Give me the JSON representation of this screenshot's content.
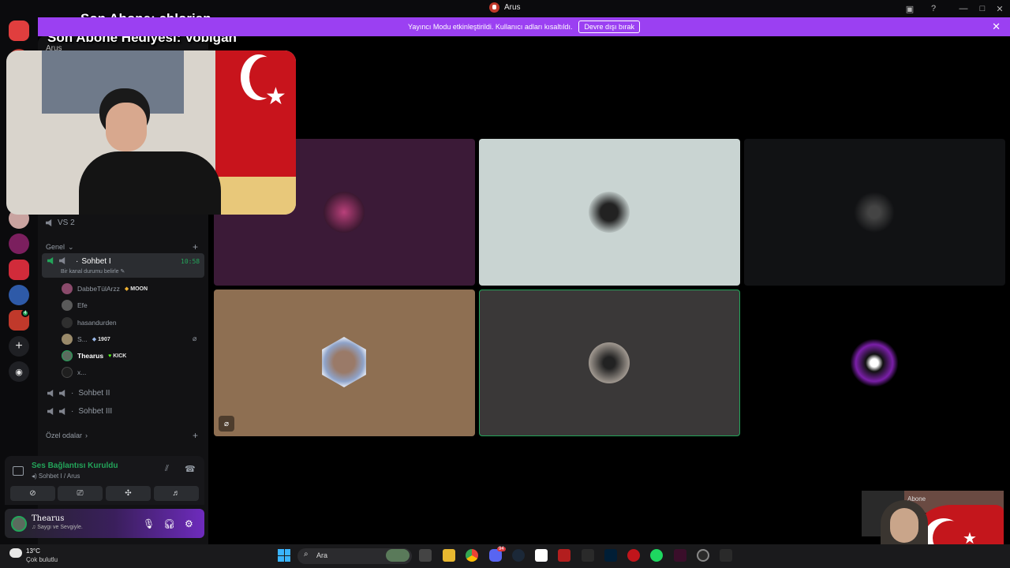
{
  "window": {
    "title": "Arus"
  },
  "banner": {
    "text": "Yayıncı Modu etkinleştirildi. Kullanıcı adları kısaltıldı.",
    "button": "Devre dışı bırak"
  },
  "overlay": {
    "line1": "Son Abone: chlorian",
    "line2": "Son Abone Hediyesi: Vobigan"
  },
  "server": {
    "name": "Arus"
  },
  "channels": {
    "vs2": "VS 2",
    "category_general": "Genel",
    "active": {
      "name": "Sohbet I",
      "time": "10:58",
      "status": "Bir kanal durumu belirle"
    },
    "members": [
      {
        "name": "DabbeTülArzz",
        "tag": "MOON"
      },
      {
        "name": "Efe",
        "tag": ""
      },
      {
        "name": "hasandurden",
        "tag": ""
      },
      {
        "name": "S...",
        "tag": "1907"
      },
      {
        "name": "Thearus",
        "tag": "KICK"
      },
      {
        "name": "x...",
        "tag": ""
      }
    ],
    "sohbet2": "Sohbet II",
    "sohbet3": "Sohbet III",
    "category_private": "Özel odalar"
  },
  "voice": {
    "title": "Ses Bağlantısı Kuruldu",
    "subtitle": "Sohbet I / Arus"
  },
  "user": {
    "name": "Thearus",
    "status": "Saygı ve Sevgiyle."
  },
  "overlay_card": {
    "label": "Abone"
  },
  "taskbar": {
    "temp": "13°C",
    "condition": "Çok bulutlu",
    "search": "Ara",
    "discord_badge": "94"
  },
  "colors": {
    "banner": "#9b40f2",
    "connected": "#23a55a",
    "sidebar": "#121214"
  }
}
